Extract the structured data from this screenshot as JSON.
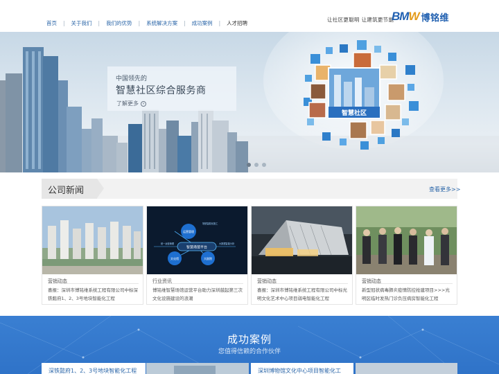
{
  "nav": {
    "items": [
      "首页",
      "关于我们",
      "我们的优势",
      "系统解决方案",
      "成功案例",
      "人才招聘"
    ],
    "separator": "|"
  },
  "header": {
    "slogan": "让社区更聪明  让建筑更节能",
    "logo_mark_b": "BM",
    "logo_mark_w": "W",
    "logo_text": "博铭维"
  },
  "banner": {
    "subtitle": "中国领先的",
    "title": "智慧社区综合服务商",
    "more": "了解更多",
    "more_icon": "arrow-circle-icon",
    "cube_label": "智慧社区",
    "slides": 3,
    "active_slide": 0
  },
  "news": {
    "section_title": "公司新闻",
    "more": "查看更多>>",
    "cards": [
      {
        "category": "营销动态",
        "text": "喜报：深圳市博铭维系统工程有限公司中标深铁懿府1、2、3号地块智能化工程"
      },
      {
        "category": "行业资讯",
        "text": "博铭维智慧场馆运营平台助力深圳鼓起第三次文化设施建设的浪潮"
      },
      {
        "category": "营销动态",
        "text": "喜报：深圳市博铭维系统工程有限公司中标光明文化艺术中心项目弱电智能化工程"
      },
      {
        "category": "营销动态",
        "text": "新型冠状病毒肺炎疫情防控抢建项目>>>光明区临时发热门诊负压病房智能化工程"
      }
    ],
    "diagram": {
      "center": "智慧场馆平台",
      "node_top": "运营管理",
      "node_left": "文化馆",
      "node_right": "大剧院",
      "label_left": "统一运营管理",
      "label_right": "大数据智能分析",
      "label_top": "场馆智能化施工"
    }
  },
  "cases": {
    "title": "成功案例",
    "subtitle": "您值得信赖的合作伙伴",
    "cards": [
      {
        "title": "深铁懿府1、2、3号地块智能化工程"
      },
      {
        "title": "深圳博物馆文化中心项目智能化工"
      }
    ]
  },
  "colors": {
    "brand_blue": "#1f5fb0",
    "nav_blue": "#2b66a8",
    "accent_orange": "#e39b1b",
    "cases_bg": "#3278cb"
  }
}
